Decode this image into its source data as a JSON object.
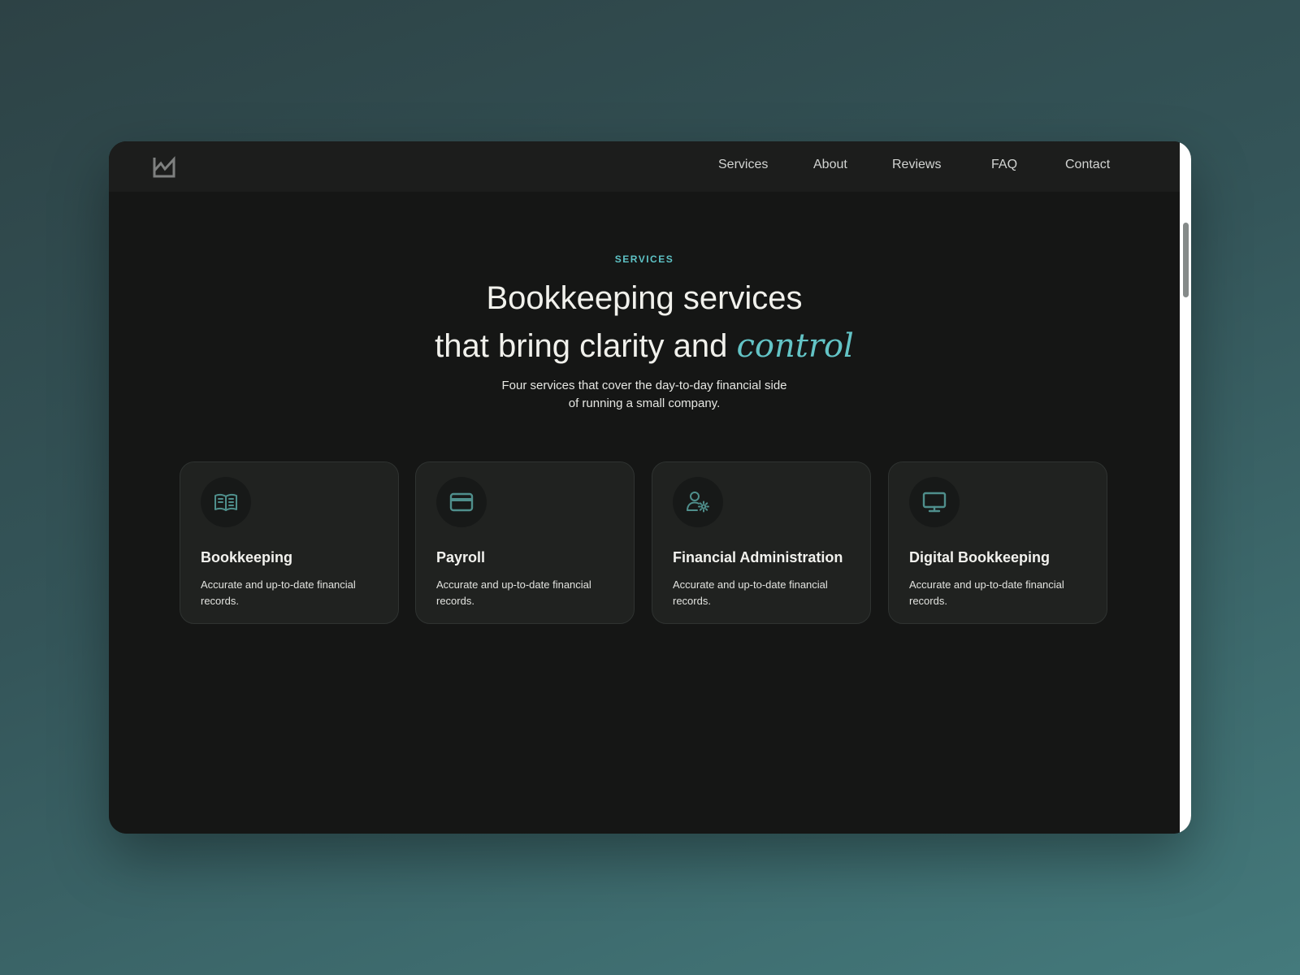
{
  "nav": {
    "logo": "logo-icon",
    "links": [
      "Services",
      "About",
      "Reviews",
      "FAQ",
      "Contact"
    ]
  },
  "hero": {
    "eyebrow": "SERVICES",
    "headline_line1": "Bookkeeping services",
    "headline_line2": "that bring clarity and",
    "headline_accent": "control",
    "subtitle_line1": "Four services that cover the day-to-day financial side",
    "subtitle_line2": "of running a small company."
  },
  "cards": [
    {
      "icon": "book-icon",
      "title": "Bookkeeping",
      "description": "Accurate and up-to-date financial records."
    },
    {
      "icon": "credit-card-icon",
      "title": "Payroll",
      "description": "Accurate and up-to-date financial records."
    },
    {
      "icon": "user-gear-icon",
      "title": "Financial Administration",
      "description": "Accurate and up-to-date financial records."
    },
    {
      "icon": "monitor-icon",
      "title": "Digital Bookkeeping",
      "description": "Accurate and up-to-date financial records."
    }
  ],
  "colors": {
    "background_gradient_start": "#2d4245",
    "background_gradient_end": "#447a7c",
    "page_background": "#151615",
    "nav_background": "#1c1d1c",
    "card_background": "#202220",
    "accent": "#5ec3c6",
    "icon": "#4f8f8c",
    "heading_text": "#f1f1ec"
  }
}
